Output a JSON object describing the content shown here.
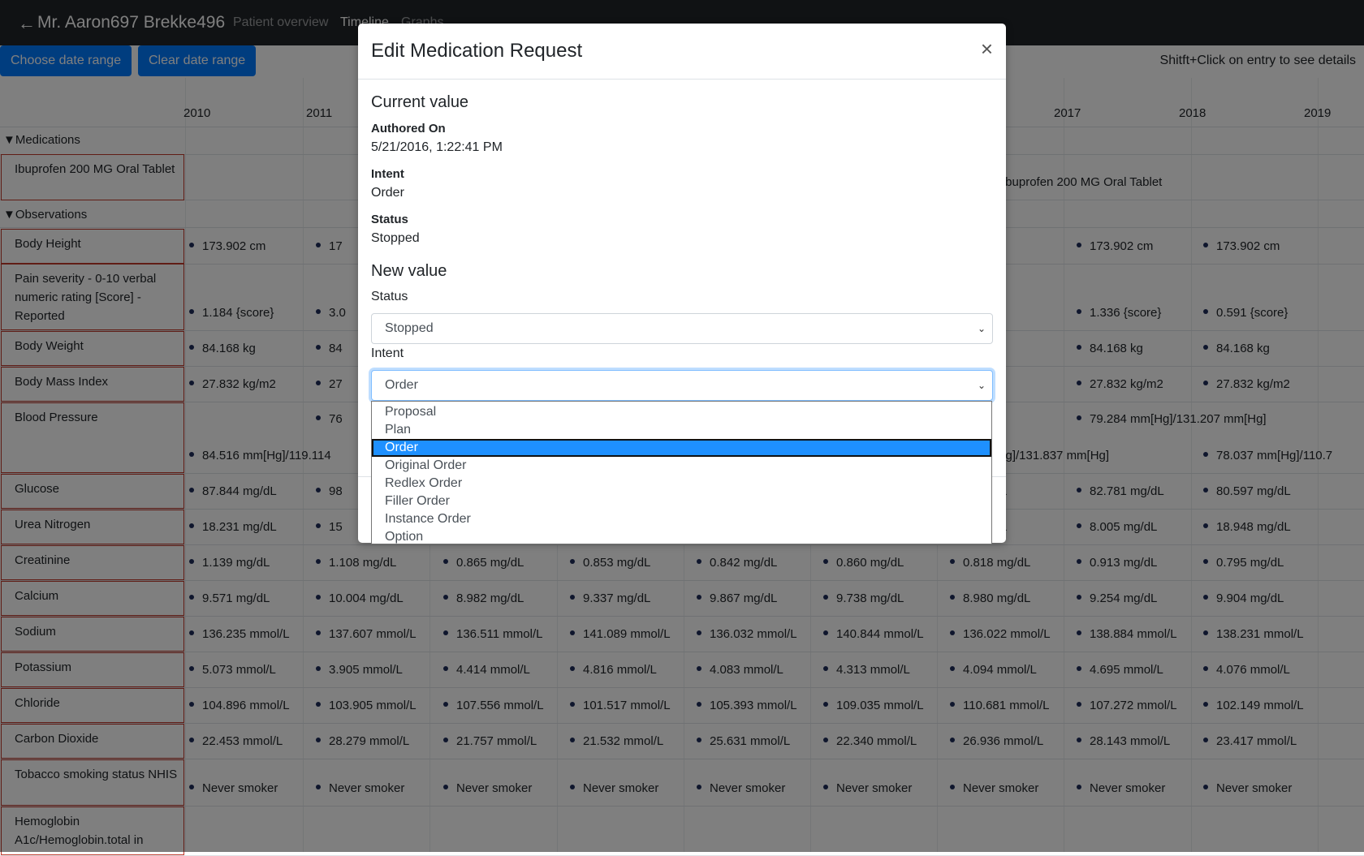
{
  "header": {
    "back_icon": "arrow-left-icon",
    "patient_name": "Mr. Aaron697 Brekke496",
    "nav": [
      "Patient overview",
      "Timeline",
      "Graphs"
    ]
  },
  "toolbar": {
    "choose_range": "Choose date range",
    "clear_range": "Clear date range",
    "hint": "Shitft+Click on entry to see details"
  },
  "timeline": {
    "years": [
      "2010",
      "2011",
      "2017",
      "2018",
      "2019"
    ],
    "sections": {
      "medications": "▼Medications",
      "observations": "▼Observations"
    },
    "medication_row": {
      "label": "Ibuprofen 200 MG Oral Tablet",
      "bar_text": "Ibuprofen 200 MG Oral Tablet"
    },
    "rows": [
      {
        "label": "Body Height",
        "cells": [
          "173.902 cm",
          "17",
          "",
          "",
          "",
          "",
          "02 cm",
          "173.902 cm",
          "173.902 cm"
        ]
      },
      {
        "label": "Pain severity - 0-10 verbal numeric rating [Score] - Reported",
        "cells": [
          "1.184 {score}",
          "3.0",
          "",
          "",
          "",
          "",
          "{score}",
          "1.336 {score}",
          "0.591 {score}"
        ]
      },
      {
        "label": "Body Weight",
        "cells": [
          "84.168 kg",
          "84",
          "",
          "",
          "",
          "",
          "8 kg",
          "84.168 kg",
          "84.168 kg"
        ]
      },
      {
        "label": "Body Mass Index",
        "cells": [
          "27.832 kg/m2",
          "27",
          "",
          "",
          "",
          "",
          "2 kg/m2",
          "27.832 kg/m2",
          "27.832 kg/m2"
        ]
      },
      {
        "label": "Blood Pressure",
        "cells_top": [
          "",
          "76",
          "",
          "",
          "",
          "",
          "m[Hg]",
          "79.284 mm[Hg]/131.207 mm[Hg]",
          ""
        ],
        "cells": [
          "84.516 mm[Hg]/119.114",
          "",
          "",
          "",
          "",
          "",
          "7 mm[Hg]/131.837 mm[Hg]",
          "",
          "78.037 mm[Hg]/110.7"
        ]
      },
      {
        "label": "Glucose",
        "cells": [
          "87.844 mg/dL",
          "98",
          "",
          "",
          "",
          "",
          "1 mg/dL",
          "82.781 mg/dL",
          "80.597 mg/dL"
        ]
      },
      {
        "label": "Urea Nitrogen",
        "cells": [
          "18.231 mg/dL",
          "15",
          "",
          "",
          "",
          "",
          "7 mg/dL",
          "8.005 mg/dL",
          "18.948 mg/dL"
        ]
      },
      {
        "label": "Creatinine",
        "cells": [
          "1.139 mg/dL",
          "1.108 mg/dL",
          "0.865 mg/dL",
          "0.853 mg/dL",
          "0.842 mg/dL",
          "0.860 mg/dL",
          "0.818 mg/dL",
          "0.913 mg/dL",
          "0.795 mg/dL"
        ]
      },
      {
        "label": "Calcium",
        "cells": [
          "9.571 mg/dL",
          "10.004 mg/dL",
          "8.982 mg/dL",
          "9.337 mg/dL",
          "9.867 mg/dL",
          "9.738 mg/dL",
          "8.980 mg/dL",
          "9.254 mg/dL",
          "9.904 mg/dL"
        ]
      },
      {
        "label": "Sodium",
        "cells": [
          "136.235 mmol/L",
          "137.607 mmol/L",
          "136.511 mmol/L",
          "141.089 mmol/L",
          "136.032 mmol/L",
          "140.844 mmol/L",
          "136.022 mmol/L",
          "138.884 mmol/L",
          "138.231 mmol/L"
        ]
      },
      {
        "label": "Potassium",
        "cells": [
          "5.073 mmol/L",
          "3.905 mmol/L",
          "4.414 mmol/L",
          "4.816 mmol/L",
          "4.083 mmol/L",
          "4.313 mmol/L",
          "4.094 mmol/L",
          "4.695 mmol/L",
          "4.076 mmol/L"
        ]
      },
      {
        "label": "Chloride",
        "cells": [
          "104.896 mmol/L",
          "103.905 mmol/L",
          "107.556 mmol/L",
          "101.517 mmol/L",
          "105.393 mmol/L",
          "109.035 mmol/L",
          "110.681 mmol/L",
          "107.272 mmol/L",
          "102.149 mmol/L"
        ]
      },
      {
        "label": "Carbon Dioxide",
        "cells": [
          "22.453 mmol/L",
          "28.279 mmol/L",
          "21.757 mmol/L",
          "21.532 mmol/L",
          "25.631 mmol/L",
          "22.340 mmol/L",
          "26.936 mmol/L",
          "28.143 mmol/L",
          "23.417 mmol/L"
        ]
      },
      {
        "label": "Tobacco smoking status NHIS",
        "cells": [
          "Never smoker",
          "Never smoker",
          "Never smoker",
          "Never smoker",
          "Never smoker",
          "Never smoker",
          "Never smoker",
          "Never smoker",
          "Never smoker"
        ]
      },
      {
        "label": "Hemoglobin A1c/Hemoglobin.total in",
        "cells": []
      }
    ]
  },
  "modal": {
    "title": "Edit Medication Request",
    "close_icon": "close-icon",
    "current_heading": "Current value",
    "authored_label": "Authored On",
    "authored_value": "5/21/2016, 1:22:41 PM",
    "intent_label": "Intent",
    "intent_value": "Order",
    "status_label": "Status",
    "status_value": "Stopped",
    "new_heading": "New value",
    "status_field_label": "Status",
    "status_selected": "Stopped",
    "intent_field_label": "Intent",
    "intent_selected": "Order",
    "intent_options": [
      "Proposal",
      "Plan",
      "Order",
      "Original Order",
      "Redlex Order",
      "Filler Order",
      "Instance Order",
      "Option"
    ]
  }
}
